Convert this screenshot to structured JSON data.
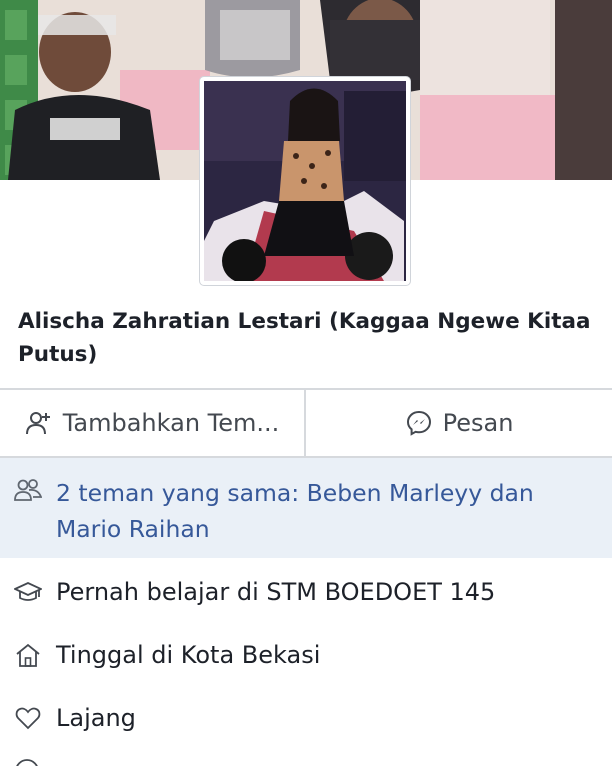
{
  "profile": {
    "name": "Alischa Zahratian Lestari (Kaggaa Ngewe Kitaa Putus)"
  },
  "actions": {
    "add_friend_label": "Tambahkan Tem...",
    "message_label": "Pesan"
  },
  "mutual_friends": {
    "text": "2 teman yang sama: Beben Marleyy dan Mario Raihan",
    "icon": "people-icon"
  },
  "info": {
    "education": {
      "text": "Pernah belajar di STM BOEDOET 145",
      "icon": "graduation-cap-icon"
    },
    "location": {
      "text": "Tinggal di Kota Bekasi",
      "icon": "home-icon"
    },
    "relationship": {
      "text": "Lajang",
      "icon": "heart-icon"
    }
  },
  "colors": {
    "link": "#365899",
    "mutual_bg": "#eaf0f7",
    "text": "#1d2129",
    "divider": "#d6d9dd"
  }
}
